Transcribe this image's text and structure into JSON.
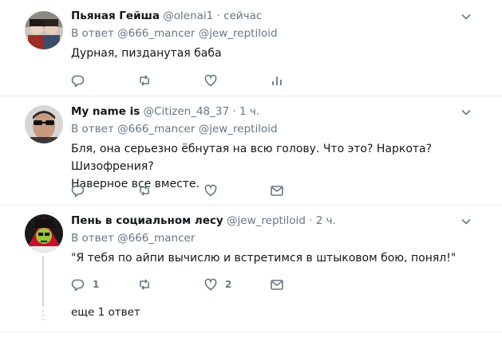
{
  "tweets": [
    {
      "name": "Пьяная Гейша",
      "handle": "@olenai1",
      "sep": "·",
      "time": "сейчас",
      "reply_prefix": "В ответ",
      "reply_mentions": [
        "@666_mancer",
        "@jew_reptiloid"
      ],
      "text": "Дурная, пизданутая баба",
      "reply_count": "",
      "like_count": ""
    },
    {
      "name": "My name is",
      "handle": "@Citizen_48_37",
      "sep": "·",
      "time": "1 ч.",
      "reply_prefix": "В ответ",
      "reply_mentions": [
        "@666_mancer",
        "@jew_reptiloid"
      ],
      "text_lines": [
        "Бля, она серьезно ёбнутая на всю голову. Что это? Наркота? Шизофрения?",
        "Наверное все вместе."
      ],
      "reply_count": "",
      "like_count": ""
    },
    {
      "name": "Пень в социальном лесу",
      "handle": "@jew_reptiloid",
      "sep": "·",
      "time": "2 ч.",
      "reply_prefix": "В ответ",
      "reply_mentions": [
        "@666_mancer"
      ],
      "text": "\"Я тебя по айпи вычислю и встретимся в штыковом бою, понял!\"",
      "reply_count": "1",
      "like_count": "2"
    }
  ],
  "more_replies": "еще 1 ответ",
  "colors": {
    "text": "#14171a",
    "secondary": "#657786",
    "border": "#e6ecf0",
    "thread": "#ccd6dd"
  }
}
